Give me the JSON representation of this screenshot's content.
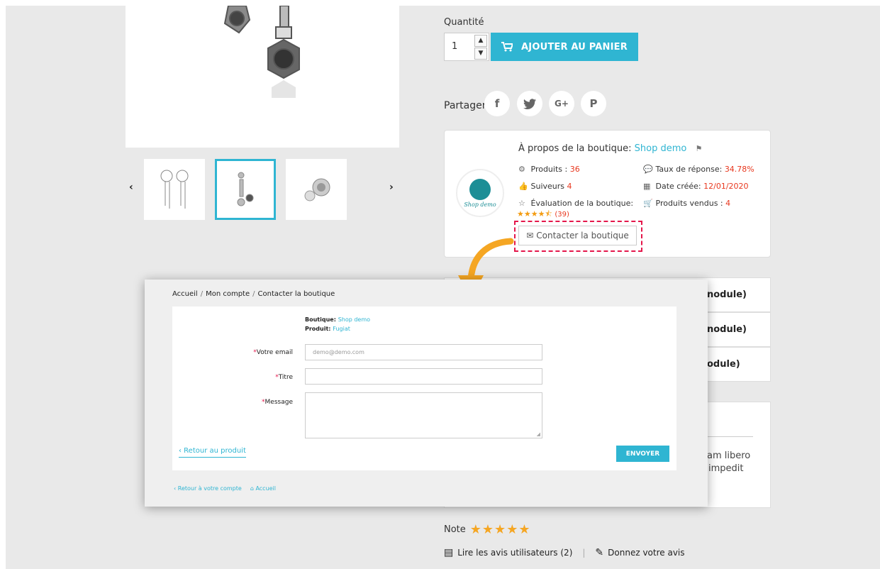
{
  "product": {
    "quantity_label": "Quantité",
    "quantity_value": "1",
    "add_to_cart_label": "AJOUTER AU PANIER",
    "share_label": "Partager",
    "social": [
      {
        "name": "facebook",
        "glyph": "f"
      },
      {
        "name": "twitter",
        "glyph": "🐦"
      },
      {
        "name": "google-plus",
        "glyph": "G+"
      },
      {
        "name": "pinterest",
        "glyph": "P"
      }
    ]
  },
  "shop": {
    "about_prefix": "À propos de la boutique: ",
    "shop_name": "Shop demo",
    "logo_text": "Shop demo",
    "products_label": "Produits : ",
    "products_value": "36",
    "followers_label": "Suiveurs ",
    "followers_value": "4",
    "rating_label": "Évaluation de la boutique:",
    "rating_count": "(39)",
    "response_label": "Taux de réponse: ",
    "response_value": "34.78%",
    "created_label": "Date créée: ",
    "created_value": "12/01/2020",
    "sold_label": "Produits vendus : ",
    "sold_value": "4",
    "contact_label": "Contacter la boutique"
  },
  "accordion": [
    "nodule)",
    "nodule)",
    "odule)"
  ],
  "description": {
    "line1": "am libero",
    "line2": "impedit"
  },
  "note_label": "Note",
  "reviews": {
    "read_label": "Lire les avis utilisateurs (2)",
    "write_label": "Donnez votre avis"
  },
  "form": {
    "breadcrumb": [
      "Accueil",
      "Mon compte",
      "Contacter la boutique"
    ],
    "shop_label": "Boutique: ",
    "shop_value": "Shop demo",
    "product_label": "Produit: ",
    "product_value": "Fugiat",
    "email_label": "Votre email",
    "email_placeholder": "demo@demo.com",
    "title_label": "Titre",
    "message_label": "Message",
    "back_label": "‹ Retour au produit",
    "send_label": "ENVOYER",
    "footer_back": "‹ Retour à votre compte",
    "footer_home": "Accueil"
  },
  "colors": {
    "accent": "#2fb5d2",
    "highlight": "#e4174b",
    "stat_red": "#e8371e",
    "star": "#f5a623"
  }
}
